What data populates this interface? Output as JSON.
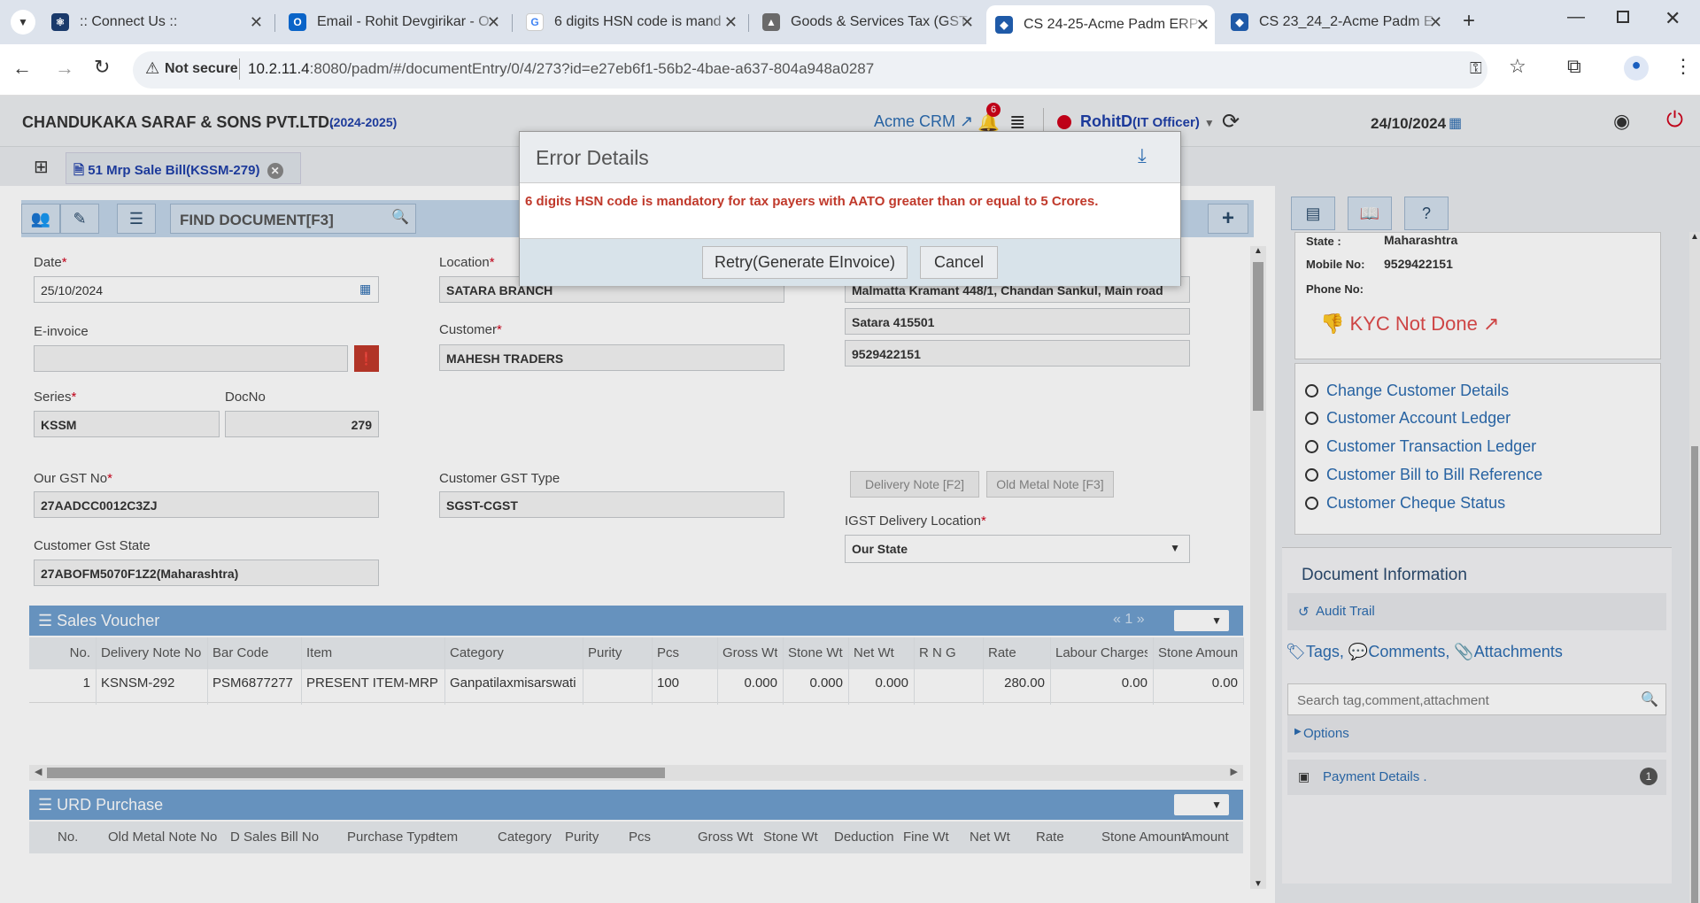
{
  "browser": {
    "tabs": [
      {
        "title": ":: Connect Us ::",
        "icon": "react-icon",
        "color": "#1a3a6b"
      },
      {
        "title": "Email - Rohit Devgirikar - O",
        "icon": "outlook-icon",
        "color": "#0a64c8"
      },
      {
        "title": "6 digits HSN code is mand",
        "icon": "google-icon",
        "color": "#4285f4"
      },
      {
        "title": "Goods & Services Tax (GST",
        "icon": "gst-icon",
        "color": "#6a6a6a"
      },
      {
        "title": "CS 24-25-Acme Padm ERP",
        "icon": "erp-icon",
        "color": "#1f5aa8"
      },
      {
        "title": "CS 23_24_2-Acme Padm E",
        "icon": "erp-icon",
        "color": "#1f5aa8"
      }
    ],
    "active_tab": 4,
    "security": "Not secure",
    "url_host": "10.2.11.4",
    "url_rest": ":8080/padm/#/documentEntry/0/4/273?id=e27eb6f1-56b2-4bae-a637-804a948a0287"
  },
  "app": {
    "company": "CHANDUKAKA SARAF & SONS PVT.LTD.",
    "year": "(2024-2025)",
    "crm_link": "Acme CRM",
    "notification_count": "6",
    "user": "RohitD",
    "role": "(IT Officer)",
    "date": "24/10/2024"
  },
  "doc_tab": {
    "label": "51 Mrp Sale Bill(KSSM-279)"
  },
  "toolbar": {
    "find_placeholder": "FIND DOCUMENT[F3]"
  },
  "form": {
    "date_label": "Date",
    "date_value": "25/10/2024",
    "location_label": "Location",
    "location_value": "SATARA BRANCH",
    "einvoice_label": "E-invoice",
    "einvoice_value": "",
    "customer_label": "Customer",
    "customer_value": "MAHESH TRADERS",
    "address1": "Malmatta Kramant 448/1, Chandan Sankul, Main road",
    "address2": "Satara 415501",
    "address3": "9529422151",
    "series_label": "Series",
    "series_value": "KSSM",
    "docno_label": "DocNo",
    "docno_value": "279",
    "delivery_note_btn": "Delivery Note [F2]",
    "old_metal_note_btn": "Old Metal Note [F3]",
    "our_gst_label": "Our GST No",
    "our_gst_value": "27AADCC0012C3ZJ",
    "cust_gst_type_label": "Customer GST Type",
    "cust_gst_type_value": "SGST-CGST",
    "igst_label": "IGST Delivery Location",
    "igst_value": "Our State",
    "cust_gst_state_label": "Customer Gst State",
    "cust_gst_state_value": "27ABOFM5070F1Z2(Maharashtra)"
  },
  "sales_voucher": {
    "title": "Sales Voucher",
    "page": "1",
    "columns": [
      "No.",
      "Delivery Note No",
      "Bar Code",
      "Item",
      "Category",
      "Purity",
      "Pcs",
      "Gross Wt",
      "Stone Wt",
      "Net Wt",
      "R N G",
      "Rate",
      "Labour Charges",
      "Stone Amount"
    ],
    "rows": [
      [
        "1",
        "KSNSM-292",
        "PSM6877277",
        "PRESENT ITEM-MRP",
        "Ganpatilaxmisarswati",
        "",
        "100",
        "0.000",
        "0.000",
        "0.000",
        "",
        "280.00",
        "0.00",
        "0.00"
      ]
    ]
  },
  "urd_purchase": {
    "title": "URD Purchase",
    "columns": [
      "No.",
      "Old Metal Note No",
      "D Sales Bill No",
      "Purchase Type",
      "Item",
      "Category",
      "Purity",
      "Pcs",
      "Gross Wt",
      "Stone Wt",
      "Deduction",
      "Fine Wt",
      "Net Wt",
      "Rate",
      "Stone Amount",
      "Amount"
    ]
  },
  "side": {
    "state_label": "State :",
    "state_value": "Maharashtra",
    "mobile_label": "Mobile No:",
    "mobile_value": "9529422151",
    "phone_label": "Phone No:",
    "phone_value": "",
    "kyc": "KYC Not Done",
    "links": [
      "Change Customer Details",
      "Customer Account Ledger",
      "Customer Transaction Ledger",
      "Customer Bill to Bill Reference",
      "Customer Cheque Status"
    ],
    "doc_info_title": "Document Information",
    "audit_trail": "Audit Trail",
    "tags": "Tags,",
    "comments": "Comments,",
    "attachments": "Attachments",
    "search_placeholder": "Search tag,comment,attachment",
    "options": "Options",
    "payment_details": "Payment Details .",
    "payment_count": "1"
  },
  "modal": {
    "title": "Error Details",
    "message": "6 digits HSN code is mandatory for tax payers with AATO greater than or equal to 5 Crores.",
    "retry_label": "Retry(Generate EInvoice)",
    "cancel_label": "Cancel"
  },
  "colors": {
    "accent": "#6f9fcf",
    "error": "#c0392b",
    "link": "#2c6cb0",
    "title_blue": "#1f3fa8"
  }
}
